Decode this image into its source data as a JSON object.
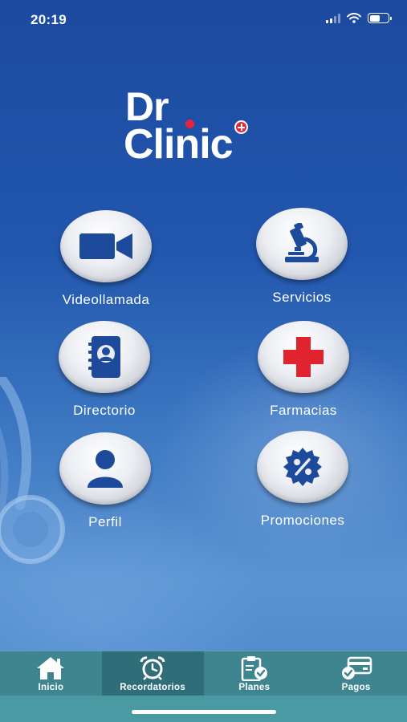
{
  "status_bar": {
    "time": "20:19"
  },
  "logo": {
    "line1": "Dr",
    "line2": "Clinic"
  },
  "menu": [
    {
      "label": "Videollamada",
      "icon": "video-camera-icon"
    },
    {
      "label": "Servicios",
      "icon": "microscope-icon"
    },
    {
      "label": "Directorio",
      "icon": "address-book-icon"
    },
    {
      "label": "Farmacias",
      "icon": "red-cross-icon"
    },
    {
      "label": "Perfil",
      "icon": "user-icon"
    },
    {
      "label": "Promociones",
      "icon": "discount-badge-icon"
    }
  ],
  "nav": [
    {
      "label": "Inicio",
      "icon": "home-icon"
    },
    {
      "label": "Recordatorios",
      "icon": "alarm-clock-icon",
      "active": true
    },
    {
      "label": "Planes",
      "icon": "clipboard-check-icon"
    },
    {
      "label": "Pagos",
      "icon": "payment-card-icon"
    }
  ],
  "colors": {
    "primary_blue": "#1d4fa6",
    "icon_blue": "#1e4a9c",
    "accent_red": "#e8243a",
    "nav_teal": "#3f8590",
    "nav_active": "#2f6d79"
  }
}
